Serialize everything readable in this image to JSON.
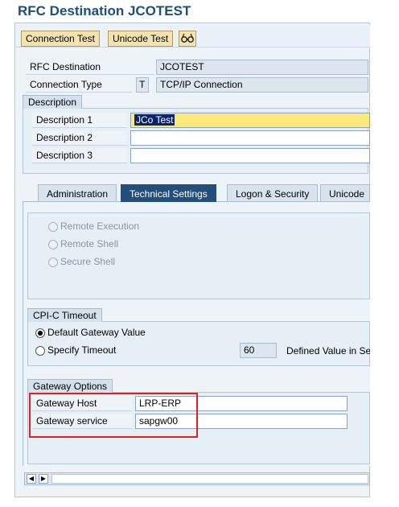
{
  "title": "RFC Destination JCOTEST",
  "toolbar": {
    "connection_test": "Connection Test",
    "unicode_test": "Unicode Test"
  },
  "header_fields": {
    "rfc_destination_label": "RFC Destination",
    "rfc_destination_value": "JCOTEST",
    "connection_type_label": "Connection Type",
    "connection_type_code": "T",
    "connection_type_value": "TCP/IP Connection"
  },
  "description": {
    "group_label": "Description",
    "desc1_label": "Description 1",
    "desc1_value": "JCo Test",
    "desc2_label": "Description 2",
    "desc2_value": "",
    "desc3_label": "Description 3",
    "desc3_value": ""
  },
  "tabs": [
    {
      "label": "Administration",
      "active": false
    },
    {
      "label": "Technical Settings",
      "active": true
    },
    {
      "label": "Logon & Security",
      "active": false
    },
    {
      "label": "Unicode",
      "active": false
    }
  ],
  "activation": {
    "remote_execution": "Remote Execution",
    "remote_shell": "Remote Shell",
    "secure_shell": "Secure Shell"
  },
  "cpic": {
    "group_label": "CPI-C Timeout",
    "default_gateway": "Default Gateway Value",
    "specify_timeout": "Specify Timeout",
    "timeout_value": "60",
    "defined_value_label": "Defined Value in Se"
  },
  "gateway": {
    "group_label": "Gateway Options",
    "host_label": "Gateway Host",
    "host_value": "LRP-ERP",
    "service_label": "Gateway service",
    "service_value": "sapgw00"
  },
  "colors": {
    "title": "#1f4e79",
    "highlight_box": "#e02020",
    "selected_field": "#ffe97a",
    "active_tab": "#234e7a"
  },
  "icons": {
    "glasses": "glasses-icon",
    "scroll_left": "scroll-left-icon",
    "scroll_right": "scroll-right-icon"
  }
}
